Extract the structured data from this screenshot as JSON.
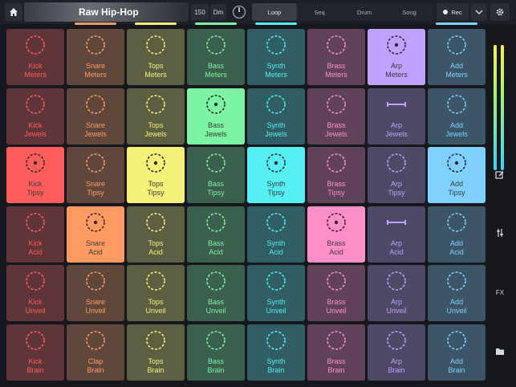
{
  "header": {
    "title": "Raw Hip-Hop",
    "tempo": "150",
    "key": "Dm",
    "modes": [
      "Loop",
      "Seq",
      "Drum",
      "Song"
    ],
    "active_mode": "Loop",
    "rec_label": "Rec"
  },
  "columns": [
    {
      "name": "Kick",
      "color": "#ff5c5c"
    },
    {
      "name": "Snare",
      "color": "#ff9b62"
    },
    {
      "name": "Tops",
      "color": "#f4f07a"
    },
    {
      "name": "Bass",
      "color": "#7cf4a3"
    },
    {
      "name": "Synth",
      "color": "#54eef3"
    },
    {
      "name": "Brass",
      "color": "#ff8ec9"
    },
    {
      "name": "Arp",
      "color": "#bfa2ff"
    },
    {
      "name": "Add",
      "color": "#7fd0ff"
    }
  ],
  "rows": [
    {
      "labels": [
        "Meters",
        "Meters",
        "Meters",
        "Meters",
        "Meters",
        "Meters",
        "Meters",
        "Meters"
      ]
    },
    {
      "labels": [
        "Jewels",
        "Jewels",
        "Jewels",
        "Jewels",
        "Jewels",
        "Jewels",
        "Jewels",
        "Jewels"
      ]
    },
    {
      "labels": [
        "Tipsy",
        "Tipsy",
        "Tipsy",
        "Tipsy",
        "Tipsy",
        "Tipsy",
        "Tipsy",
        "Tipsy"
      ]
    },
    {
      "labels": [
        "Acid",
        "Acid",
        "Acid",
        "Acid",
        "Acid",
        "Acid",
        "Acid",
        "Acid"
      ]
    },
    {
      "labels": [
        "Unveil",
        "Unveil",
        "Unveil",
        "Unveil",
        "Unveil",
        "Unveil",
        "Unveil",
        "Unveil"
      ]
    },
    {
      "labels": [
        "Brain",
        "Brain",
        "Brain",
        "Brain",
        "Brain",
        "Brain",
        "Brain",
        "Brain"
      ]
    }
  ],
  "pads": [
    [
      "Kick",
      "Snare",
      "Tops",
      "Bass",
      "Synth",
      "Brass",
      "Arp",
      "Add"
    ],
    [
      "Kick",
      "Snare",
      "Tops",
      "Bass",
      "Synth",
      "Brass",
      "Arp",
      "Add"
    ],
    [
      "Kick",
      "Snare",
      "Tops",
      "Bass",
      "Synth",
      "Brass",
      "Arp",
      "Add"
    ],
    [
      "Kick",
      "Snare",
      "Tops",
      "Bass",
      "Synth",
      "Brass",
      "Arp",
      "Add"
    ],
    [
      "Kick",
      "Snare",
      "Tops",
      "Bass",
      "Synth",
      "Brass",
      "Arp",
      "Add"
    ],
    [
      "Kick",
      "Clap",
      "Tops",
      "Bass",
      "Synth",
      "Brass",
      "Arp",
      "Add"
    ]
  ],
  "active_pads": {
    "0": [
      6
    ],
    "1": [
      3
    ],
    "2": [
      0,
      2,
      4,
      7
    ],
    "3": [
      1,
      5
    ]
  },
  "right_panel": {
    "fx_label": "FX"
  }
}
